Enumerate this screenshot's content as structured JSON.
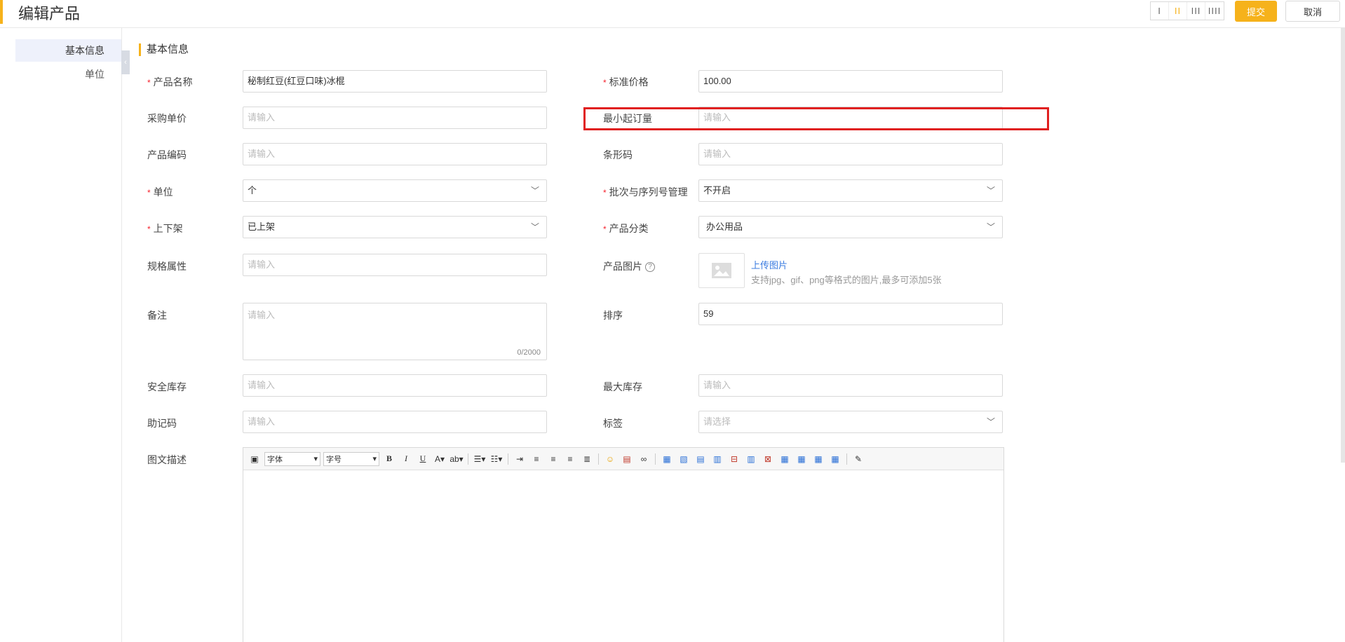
{
  "header": {
    "title": "编辑产品",
    "layout_options": [
      "I",
      "II",
      "III",
      "IIII"
    ],
    "active_layout": 1,
    "submit_label": "提交",
    "cancel_label": "取消"
  },
  "sidebar": {
    "items": [
      {
        "label": "基本信息",
        "active": true
      },
      {
        "label": "单位",
        "active": false
      }
    ]
  },
  "section": {
    "title": "基本信息"
  },
  "form": {
    "product_name": {
      "label": "产品名称",
      "required": true,
      "value": "秘制红豆(红豆口味)冰棍"
    },
    "standard_price": {
      "label": "标准价格",
      "required": true,
      "value": "100.00"
    },
    "purchase_price": {
      "label": "采购单价",
      "placeholder": "请输入"
    },
    "min_order_qty": {
      "label": "最小起订量",
      "placeholder": "请输入"
    },
    "product_code": {
      "label": "产品编码",
      "placeholder": "请输入"
    },
    "barcode": {
      "label": "条形码",
      "placeholder": "请输入"
    },
    "unit": {
      "label": "单位",
      "required": true,
      "value": "个"
    },
    "batch_serial": {
      "label": "批次与序列号管理",
      "required": true,
      "value": "不开启"
    },
    "listing": {
      "label": "上下架",
      "required": true,
      "value": "已上架"
    },
    "category": {
      "label": "产品分类",
      "required": true,
      "value": "办公用品"
    },
    "spec": {
      "label": "规格属性",
      "placeholder": "请输入"
    },
    "image": {
      "label": "产品图片",
      "upload_label": "上传图片",
      "hint": "支持jpg、gif、png等格式的图片,最多可添加5张"
    },
    "remark": {
      "label": "备注",
      "placeholder": "请输入",
      "counter": "0/2000"
    },
    "sort": {
      "label": "排序",
      "value": "59"
    },
    "safety_stock": {
      "label": "安全库存",
      "placeholder": "请输入"
    },
    "max_stock": {
      "label": "最大库存",
      "placeholder": "请输入"
    },
    "mnemonic": {
      "label": "助记码",
      "placeholder": "请输入"
    },
    "tags": {
      "label": "标签",
      "placeholder": "请选择"
    },
    "description": {
      "label": "图文描述",
      "font_label": "字体",
      "size_label": "字号"
    }
  },
  "colors": {
    "accent": "#f6b21b",
    "highlight": "#e02020",
    "link": "#3a7be0"
  }
}
